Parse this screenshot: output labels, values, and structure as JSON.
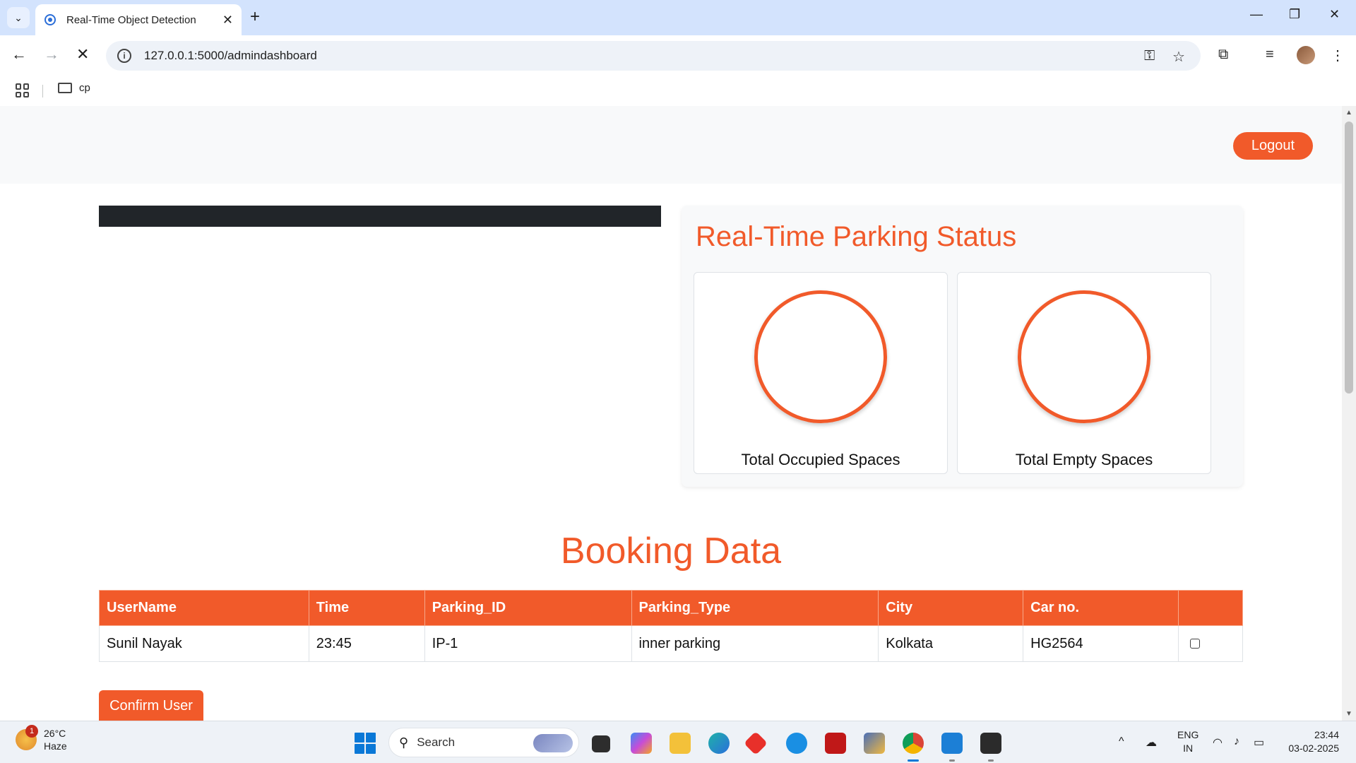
{
  "browser": {
    "tab_title": "Real-Time Object Detection",
    "url": "127.0.0.1:5000/admindashboard",
    "bookmark_folder": "cp"
  },
  "header": {
    "logout_label": "Logout"
  },
  "status": {
    "title": "Real-Time Parking Status",
    "occupied_label": "Total Occupied Spaces",
    "empty_label": "Total Empty Spaces"
  },
  "booking": {
    "title": "Booking Data",
    "columns": [
      "UserName",
      "Time",
      "Parking_ID",
      "Parking_Type",
      "City",
      "Car no.",
      ""
    ],
    "rows": [
      [
        "Sunil Nayak",
        "23:45",
        "IP-1",
        "inner parking",
        "Kolkata",
        "HG2564"
      ]
    ],
    "confirm_label": "Confirm User"
  },
  "taskbar": {
    "weather_temp": "26°C",
    "weather_desc": "Haze",
    "weather_badge": "1",
    "search_placeholder": "Search",
    "lang_top": "ENG",
    "lang_bottom": "IN",
    "time": "23:44",
    "date": "03-02-2025"
  },
  "colors": {
    "accent": "#f15a2a",
    "dark_bar": "#212529"
  }
}
